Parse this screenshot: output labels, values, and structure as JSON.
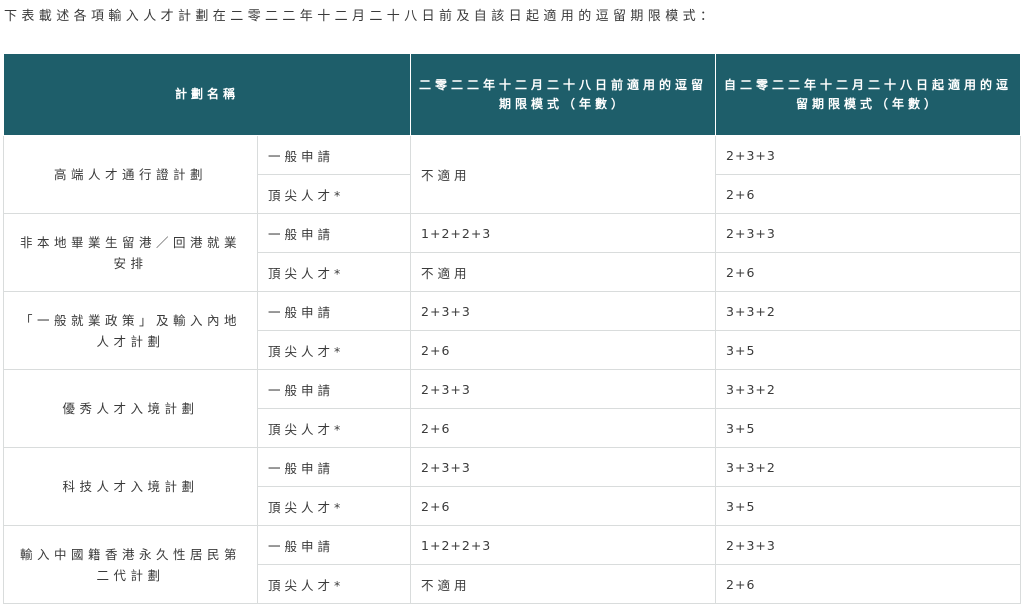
{
  "intro": "下表載述各項輸入人才計劃在二零二二年十二月二十八日前及自該日起適用的逗留期限模式：",
  "table": {
    "headers": [
      "計劃名稱",
      "二零二二年十二月二十八日前適用的逗留期限模式（年數）",
      "自二零二二年十二月二十八日起適用的逗留期限模式（年數）"
    ],
    "schemes": [
      {
        "name": "高端人才通行證計劃",
        "rows": [
          {
            "category": "一般申請",
            "before": "不適用",
            "after": "2+3+3"
          },
          {
            "category": "頂尖人才*",
            "before": "",
            "after": "2+6"
          }
        ]
      },
      {
        "name": "非本地畢業生留港／回港就業安排",
        "rows": [
          {
            "category": "一般申請",
            "before": "1+2+2+3",
            "after": "2+3+3"
          },
          {
            "category": "頂尖人才*",
            "before": "不適用",
            "after": "2+6"
          }
        ]
      },
      {
        "name": "「一般就業政策」及輸入內地人才計劃",
        "rows": [
          {
            "category": "一般申請",
            "before": "2+3+3",
            "after": "3+3+2"
          },
          {
            "category": "頂尖人才*",
            "before": "2+6",
            "after": "3+5"
          }
        ]
      },
      {
        "name": "優秀人才入境計劃",
        "rows": [
          {
            "category": "一般申請",
            "before": "2+3+3",
            "after": "3+3+2"
          },
          {
            "category": "頂尖人才*",
            "before": "2+6",
            "after": "3+5"
          }
        ]
      },
      {
        "name": "科技人才入境計劃",
        "rows": [
          {
            "category": "一般申請",
            "before": "2+3+3",
            "after": "3+3+2"
          },
          {
            "category": "頂尖人才*",
            "before": "2+6",
            "after": "3+5"
          }
        ]
      },
      {
        "name": "輸入中國籍香港永久性居民第二代計劃",
        "rows": [
          {
            "category": "一般申請",
            "before": "1+2+2+3",
            "after": "2+3+3"
          },
          {
            "category": "頂尖人才*",
            "before": "不適用",
            "after": "2+6"
          }
        ]
      }
    ]
  },
  "colors": {
    "header_bg": "#1e5e6a",
    "header_text": "#ffffff",
    "border": "#d9dcdc",
    "text": "#3a3a3a"
  }
}
